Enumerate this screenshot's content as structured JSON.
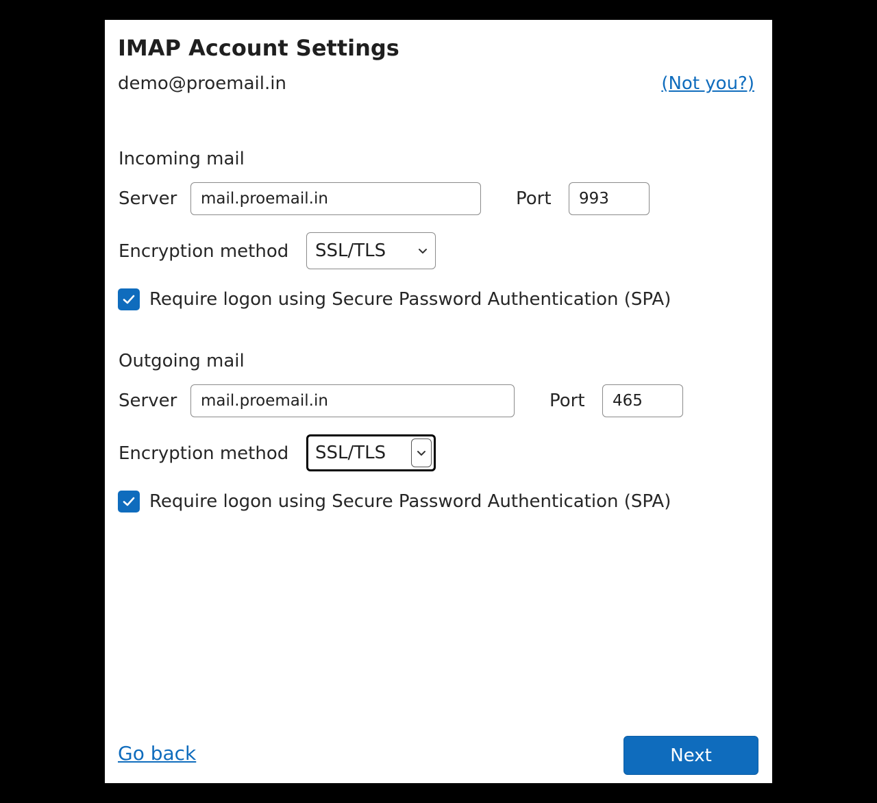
{
  "dialog": {
    "title": "IMAP Account Settings",
    "email": "demo@proemail.in",
    "not_you_link": "(Not you?)"
  },
  "incoming": {
    "section_label": "Incoming mail",
    "server_label": "Server",
    "server_value": "mail.proemail.in",
    "port_label": "Port",
    "port_value": "993",
    "encryption_label": "Encryption method",
    "encryption_value": "SSL/TLS",
    "spa_checked": true,
    "spa_label": "Require logon using Secure Password Authentication (SPA)"
  },
  "outgoing": {
    "section_label": "Outgoing mail",
    "server_label": "Server",
    "server_value": "mail.proemail.in",
    "port_label": "Port",
    "port_value": "465",
    "encryption_label": "Encryption method",
    "encryption_value": "SSL/TLS",
    "spa_checked": true,
    "spa_label": "Require logon using Secure Password Authentication (SPA)"
  },
  "footer": {
    "go_back_label": "Go back",
    "next_label": "Next"
  },
  "colors": {
    "accent": "#0f6cbd",
    "background": "#000000",
    "panel": "#ffffff"
  },
  "icons": {
    "checkbox": "checkmark-icon",
    "select": "chevron-down-icon"
  }
}
